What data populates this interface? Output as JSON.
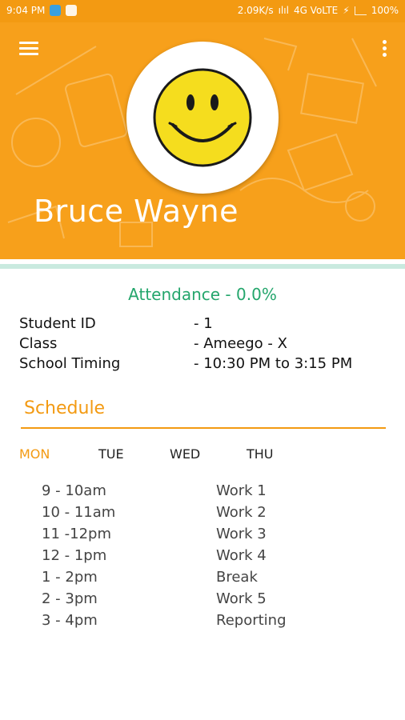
{
  "status_bar": {
    "time": "9:04 PM",
    "network_speed": "2.09K/s",
    "network_type": "4G VoLTE",
    "battery": "100%"
  },
  "header": {
    "student_name": "Bruce Wayne",
    "menu_icon": "hamburger-menu-icon",
    "more_icon": "more-vert-icon",
    "avatar": "smiley-face"
  },
  "profile": {
    "attendance": "Attendance - 0.0%",
    "info": [
      {
        "label": "Student ID",
        "value": "- 1"
      },
      {
        "label": "Class",
        "value": "- Ameego - X"
      },
      {
        "label": "School Timing",
        "value": "- 10:30 PM to 3:15 PM"
      }
    ]
  },
  "schedule": {
    "title": "Schedule",
    "days": [
      {
        "label": "MON",
        "active": true
      },
      {
        "label": "TUE",
        "active": false
      },
      {
        "label": "WED",
        "active": false
      },
      {
        "label": "THU",
        "active": false
      }
    ],
    "slots": [
      {
        "time": "9 - 10am",
        "task": "Work 1"
      },
      {
        "time": "10 - 11am",
        "task": "Work 2"
      },
      {
        "time": "11 -12pm",
        "task": "Work 3"
      },
      {
        "time": "12 - 1pm",
        "task": "Work 4"
      },
      {
        "time": "1 - 2pm",
        "task": "Break"
      },
      {
        "time": "2 - 3pm",
        "task": "Work 5"
      },
      {
        "time": "3 - 4pm",
        "task": "Reporting"
      }
    ]
  },
  "colors": {
    "accent": "#f39a12",
    "header_bg": "#f7a01b",
    "attendance": "#24a66c",
    "divider": "#c9eadf"
  }
}
